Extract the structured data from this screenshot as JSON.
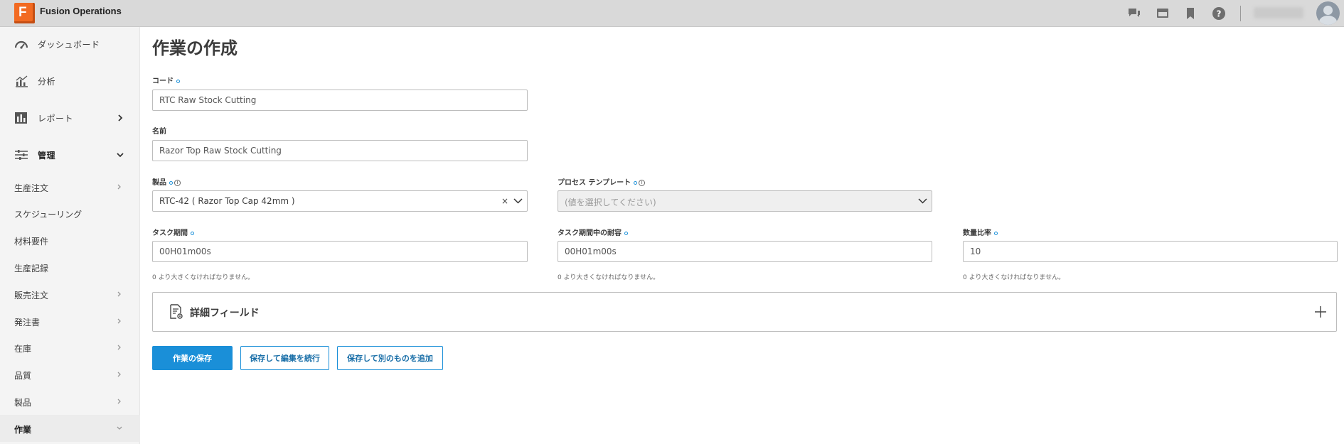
{
  "app": {
    "title": "Fusion Operations",
    "logo_letter": "F"
  },
  "topbar": {
    "icons": [
      "chat-icon",
      "screen-icon",
      "bookmark-icon",
      "help-icon",
      "avatar"
    ]
  },
  "sidebar": {
    "top_items": [
      {
        "label": "ダッシュボード",
        "icon": "dashboard-icon"
      },
      {
        "label": "分析",
        "icon": "analytics-icon"
      },
      {
        "label": "レポート",
        "icon": "report-icon"
      },
      {
        "label": "管理",
        "icon": "settings-sliders-icon"
      }
    ],
    "sub_items": [
      {
        "label": "生産注文"
      },
      {
        "label": "スケジューリング"
      },
      {
        "label": "材料要件"
      },
      {
        "label": "生産記録"
      },
      {
        "label": "販売注文"
      },
      {
        "label": "発注書"
      },
      {
        "label": "在庫"
      },
      {
        "label": "品質"
      },
      {
        "label": "製品"
      },
      {
        "label": "作業"
      }
    ]
  },
  "page": {
    "title": "作業の作成"
  },
  "form": {
    "code": {
      "label": "コード",
      "value": "RTC Raw Stock Cutting"
    },
    "name": {
      "label": "名前",
      "value": "Razor Top Raw Stock Cutting"
    },
    "product": {
      "label": "製品",
      "value": "RTC-42 ( Razor Top Cap 42mm )",
      "clear": "×"
    },
    "process_template": {
      "label": "プロセス テンプレート",
      "placeholder": "(値を選択してください)"
    },
    "task_duration": {
      "label": "タスク期間",
      "value": "00H01m00s",
      "hint": "0 より大きくなければなりません。"
    },
    "task_duration_tolerance": {
      "label": "タスク期間中の耐容",
      "value": "00H01m00s",
      "hint": "0 より大きくなければなりません。"
    },
    "quantity_ratio": {
      "label": "数量比率",
      "value": "10",
      "hint": "0 より大きくなければなりません。"
    }
  },
  "details": {
    "title": "詳細フィールド"
  },
  "buttons": {
    "save": "作業の保存",
    "save_continue": "保存して編集を続行",
    "save_add": "保存して別のものを追加"
  },
  "colors": {
    "accent": "#1a8fd8",
    "logo": "#f26a21"
  }
}
